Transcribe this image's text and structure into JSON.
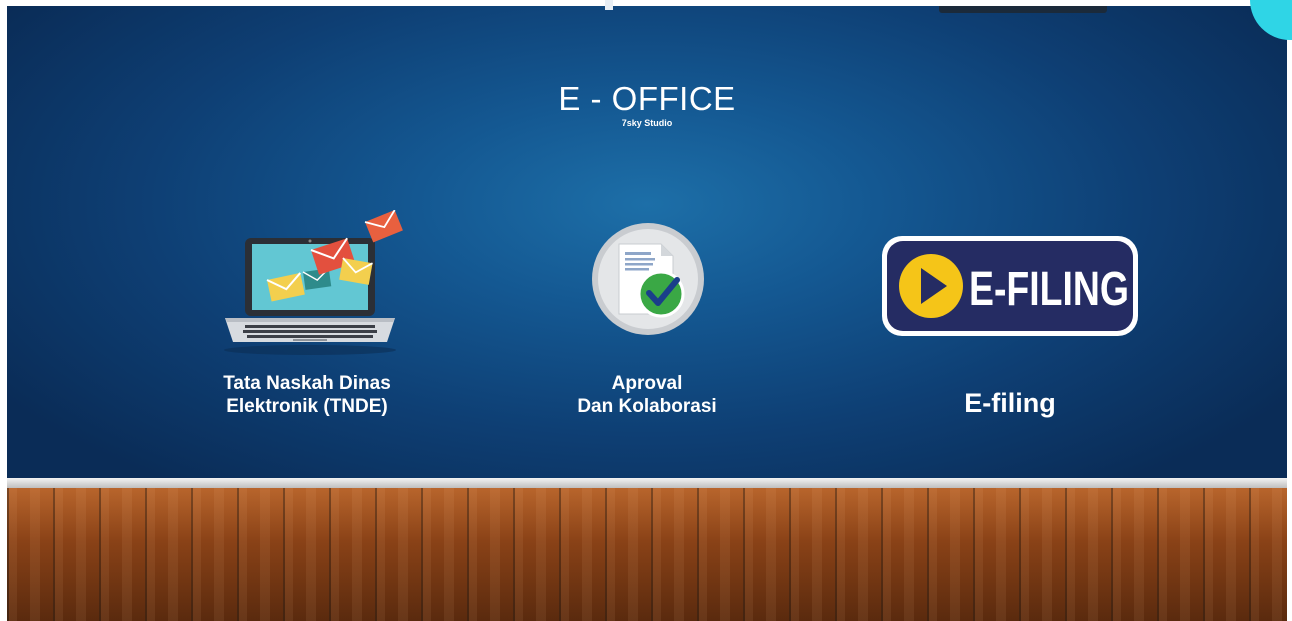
{
  "header": {
    "title": "E - OFFICE",
    "subtitle": "7sky Studio"
  },
  "apps": [
    {
      "id": "tnde",
      "label_line1": "Tata Naskah Dinas",
      "label_line2": "Elektronik (TNDE)",
      "icon": "laptop-mail-icon"
    },
    {
      "id": "approval",
      "label_line1": "Aproval",
      "label_line2": "Dan Kolaborasi",
      "icon": "document-check-icon"
    },
    {
      "id": "efiling",
      "label": "E-filing",
      "icon": "efiling-logo",
      "logo_text": "E-FILING"
    }
  ],
  "colors": {
    "background_top": "#145892",
    "background_edge": "#0a2c57",
    "efiling_navy": "#252c63",
    "efiling_yellow": "#f5c518",
    "check_green": "#3aa845",
    "mail_red": "#e3503e",
    "mail_yellow": "#f3cf4e",
    "corner_accent": "#2fd5e6"
  }
}
